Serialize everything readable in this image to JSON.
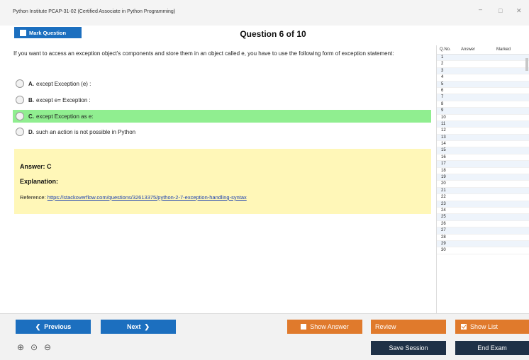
{
  "window": {
    "title": "Python Institute PCAP-31-02 (Certified Associate in Python Programming)",
    "controls": {
      "minimize": "–",
      "maximize": "□",
      "close": "✕"
    }
  },
  "header": {
    "mark_label": "Mark Question",
    "question_heading": "Question 6 of 10"
  },
  "question": {
    "text": "If you want to access an exception object's components and store them in an object called e, you have to use the following form of exception statement:",
    "options": [
      {
        "letter": "A.",
        "text": "except Exception (e) :"
      },
      {
        "letter": "B.",
        "text": "except e= Exception :"
      },
      {
        "letter": "C.",
        "text": "except Exception as e:"
      },
      {
        "letter": "D.",
        "text": "such an action is not possible in Python"
      }
    ],
    "selected_index": 2
  },
  "answer": {
    "answer_label": "Answer: C",
    "explanation_label": "Explanation:",
    "reference_prefix": "Reference: ",
    "reference_link": "https://stackoverflow.com/questions/32613375/python-2-7-exception-handling-syntax"
  },
  "sidebar": {
    "columns": [
      "Q.No.",
      "Answer",
      "Marked"
    ],
    "rows": [
      "1",
      "2",
      "3",
      "4",
      "5",
      "6",
      "7",
      "8",
      "9",
      "10",
      "11",
      "12",
      "13",
      "14",
      "15",
      "16",
      "17",
      "18",
      "19",
      "20",
      "21",
      "22",
      "23",
      "24",
      "25",
      "26",
      "27",
      "28",
      "29",
      "30"
    ]
  },
  "buttons": {
    "previous": "Previous",
    "next": "Next",
    "show_answer": "Show Answer",
    "review": "Review",
    "show_list": "Show List",
    "save_session": "Save Session",
    "end_exam": "End Exam"
  },
  "colors": {
    "primary": "#1c6fbf",
    "orange": "#e07a2c",
    "dark": "#1f3147",
    "selected": "#90ee90",
    "answer_bg": "#fff7b8"
  }
}
